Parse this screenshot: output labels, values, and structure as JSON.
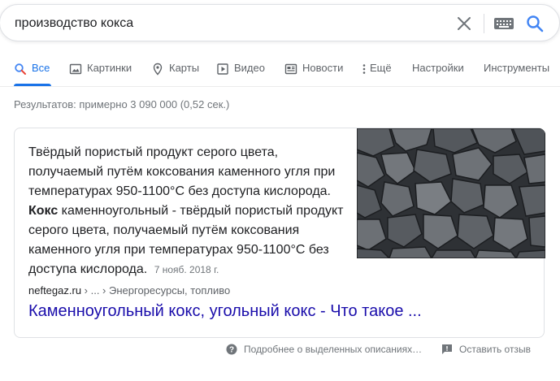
{
  "search": {
    "query": "производство кокса",
    "clear_icon": "close-icon",
    "keyboard_icon": "keyboard-icon",
    "search_icon": "search-icon"
  },
  "tabs": [
    {
      "label": "Все",
      "icon": "search-icon",
      "active": true
    },
    {
      "label": "Картинки",
      "icon": "image-icon"
    },
    {
      "label": "Карты",
      "icon": "map-pin-icon"
    },
    {
      "label": "Видео",
      "icon": "video-icon"
    },
    {
      "label": "Новости",
      "icon": "news-icon"
    },
    {
      "label": "Ещё",
      "icon": "more-vert-icon"
    },
    {
      "label": "Настройки"
    },
    {
      "label": "Инструменты"
    }
  ],
  "stats": "Результатов: примерно 3 090 000 (0,52 сек.)",
  "featured_snippet": {
    "text_part1": "Твёрдый пористый продукт серого цвета, получаемый путём коксования каменного угля при температурах 950-1100°С без доступа кислорода.",
    "bold_term": "Кокс",
    "text_part2": " каменноугольный - твёрдый пористый продукт серого цвета, получаемый путём коксования каменного угля при температурах 950-1100°С без доступа кислорода.",
    "date": "7 нояб. 2018 г.",
    "image_alt": "coal-coke-image",
    "breadcrumb_site": "neftegaz.ru",
    "breadcrumb_sep1": " › ... › ",
    "breadcrumb_tail": "Энергоресурсы, топливо",
    "link_title": "Каменноугольный кокс, угольный кокс - Что такое ..."
  },
  "footer": {
    "about_label": "Подробнее о выделенных описаниях…",
    "feedback_label": "Оставить отзыв"
  },
  "colors": {
    "accent": "#1a73e8",
    "link": "#1a0dab",
    "muted": "#70757a"
  }
}
